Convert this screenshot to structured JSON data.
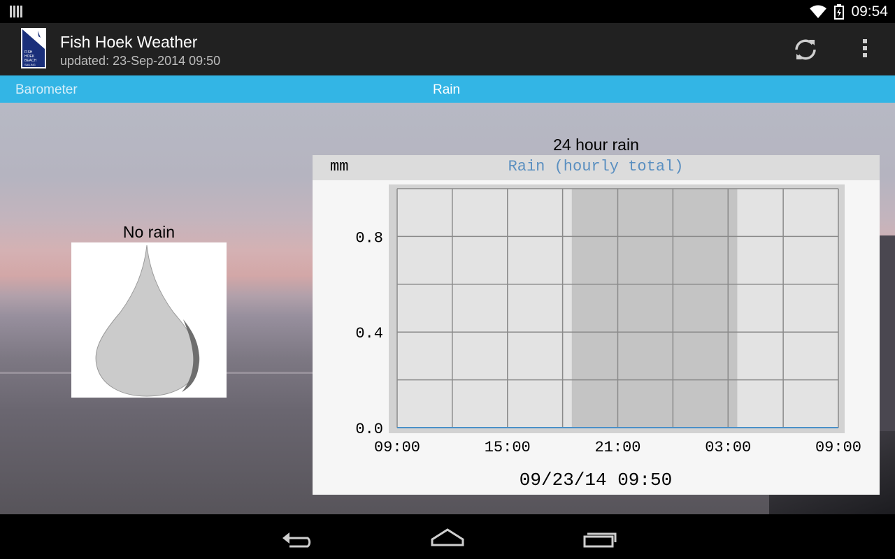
{
  "status_bar": {
    "time": "09:54"
  },
  "app_bar": {
    "title": "Fish Hoek Weather",
    "subtitle": "updated: 23-Sep-2014 09:50",
    "logo_text": "FISH HOEK BEACH SAILING CLUB",
    "actions": [
      "refresh-icon",
      "overflow-menu-icon"
    ]
  },
  "tabs": {
    "previous": "Barometer",
    "current": "Rain"
  },
  "rain_status": {
    "label": "No rain",
    "icon": "raindrop-icon"
  },
  "chart_caption": "24 hour rain",
  "chart_data": {
    "type": "line",
    "title": "Rain (hourly total)",
    "ylabel": "mm",
    "xlabel": "",
    "x_ticks": [
      "09:00",
      "15:00",
      "21:00",
      "03:00",
      "09:00"
    ],
    "y_ticks": [
      "0.0",
      "0.4",
      "0.8"
    ],
    "ylim": [
      0,
      1.0
    ],
    "x_hours": [
      0,
      24
    ],
    "night_shading": {
      "from_hour": 9.5,
      "to_hour": 18.5
    },
    "grid": true,
    "series": [
      {
        "x": [
          0,
          3,
          6,
          9,
          12,
          15,
          18,
          21,
          24
        ],
        "values": [
          0,
          0,
          0,
          0,
          0,
          0,
          0,
          0,
          0
        ]
      }
    ],
    "timestamp": "09/23/14 09:50",
    "colors": {
      "line": "#4a90c8",
      "title": "#5a8fc0",
      "plot_bg": "#e3e3e3",
      "night": "#c4c4c4",
      "grid": "#8a8a8a"
    }
  },
  "colors": {
    "accent": "#33b5e5",
    "action_bar": "#212121"
  }
}
